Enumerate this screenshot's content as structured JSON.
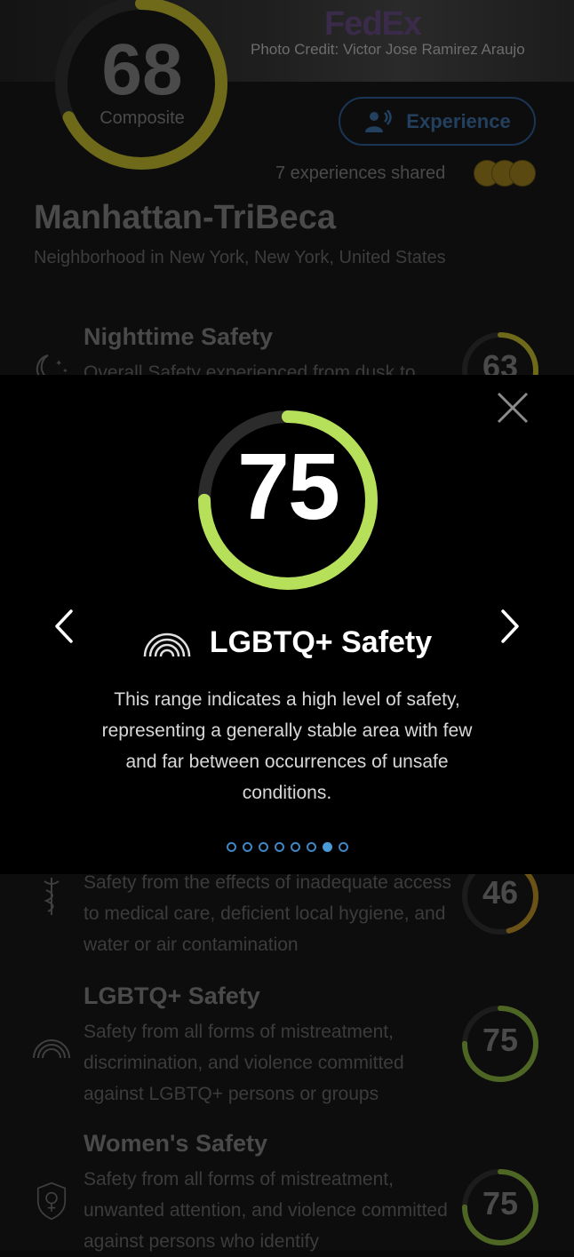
{
  "hero": {
    "brand_text": "FedEx",
    "photo_credit": "Photo Credit: Victor Jose Ramirez Araujo"
  },
  "composite": {
    "value": "68",
    "label": "Composite",
    "progress": 0.68,
    "color": "#6e6a1a"
  },
  "experience_button": {
    "label": "Experience",
    "icon": "speaking-person-icon"
  },
  "experiences_shared": "7 experiences shared",
  "location": {
    "name": "Manhattan-TriBeca",
    "subtitle": "Neighborhood in New York, New York, United States"
  },
  "categories": [
    {
      "title": "Nighttime Safety",
      "description": "Overall Safety experienced from dusk to",
      "value": "63",
      "progress": 0.63,
      "icon": "moon-stars-icon",
      "color": "#6e6a1a"
    },
    {
      "title": "",
      "description": "Safety from the effects of inadequate access to medical care, deficient local hygiene, and water or air contamination",
      "value": "46",
      "progress": 0.46,
      "icon": "medical-caduceus-icon",
      "color": "#6b5317"
    },
    {
      "title": "LGBTQ+ Safety",
      "description": "Safety from all forms of mistreatment, discrimination, and violence committed against LGBTQ+ persons or groups",
      "value": "75",
      "progress": 0.75,
      "icon": "rainbow-icon",
      "color": "#4e6624"
    },
    {
      "title": "Women's Safety",
      "description": "Safety from all forms of mistreatment, unwanted attention, and violence committed against persons who identify",
      "value": "75",
      "progress": 0.75,
      "icon": "shield-female-icon",
      "color": "#4e6624"
    }
  ],
  "modal": {
    "value": "75",
    "progress": 0.75,
    "ring_color": "#b7e05a",
    "title": "LGBTQ+ Safety",
    "title_icon": "rainbow-icon",
    "description": "This range indicates a high level of safety, representing a generally stable area with few and far between occurrences of unsafe conditions.",
    "page_count": 8,
    "active_page": 7,
    "dot_color": "#4a9ad8"
  }
}
